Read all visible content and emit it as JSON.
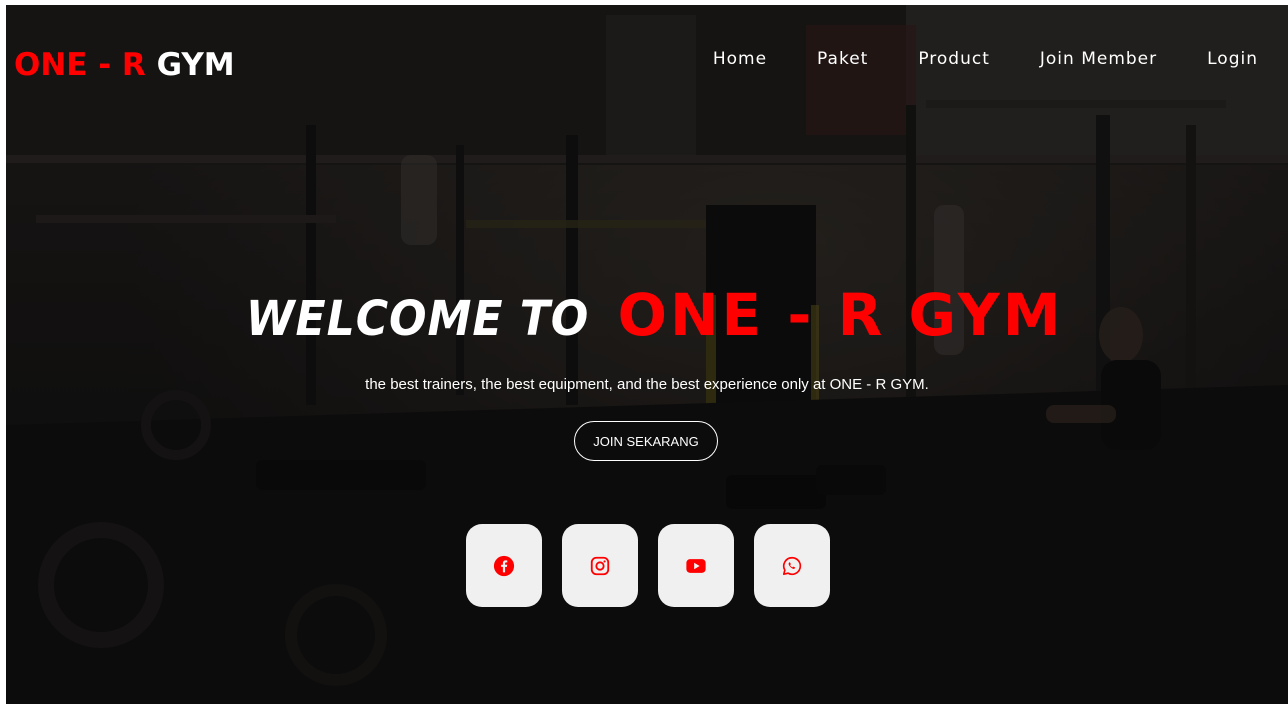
{
  "logo": {
    "red_part": "ONE - R ",
    "white_part": "GYM"
  },
  "nav": {
    "items": [
      {
        "label": "Home"
      },
      {
        "label": "Paket"
      },
      {
        "label": "Product"
      },
      {
        "label": "Join Member"
      },
      {
        "label": "Login"
      }
    ]
  },
  "hero": {
    "title_white": "WELCOME TO",
    "title_red": "ONE - R GYM",
    "subtitle": "the best trainers, the best equipment, and the best experience only at ONE - R GYM.",
    "cta_label": "JOIN SEKARANG"
  },
  "socials": [
    {
      "icon": "facebook-icon"
    },
    {
      "icon": "instagram-icon"
    },
    {
      "icon": "youtube-icon"
    },
    {
      "icon": "whatsapp-icon"
    }
  ],
  "colors": {
    "accent": "#ff0000",
    "text": "#ffffff",
    "social_bg": "#f1f0f0"
  }
}
